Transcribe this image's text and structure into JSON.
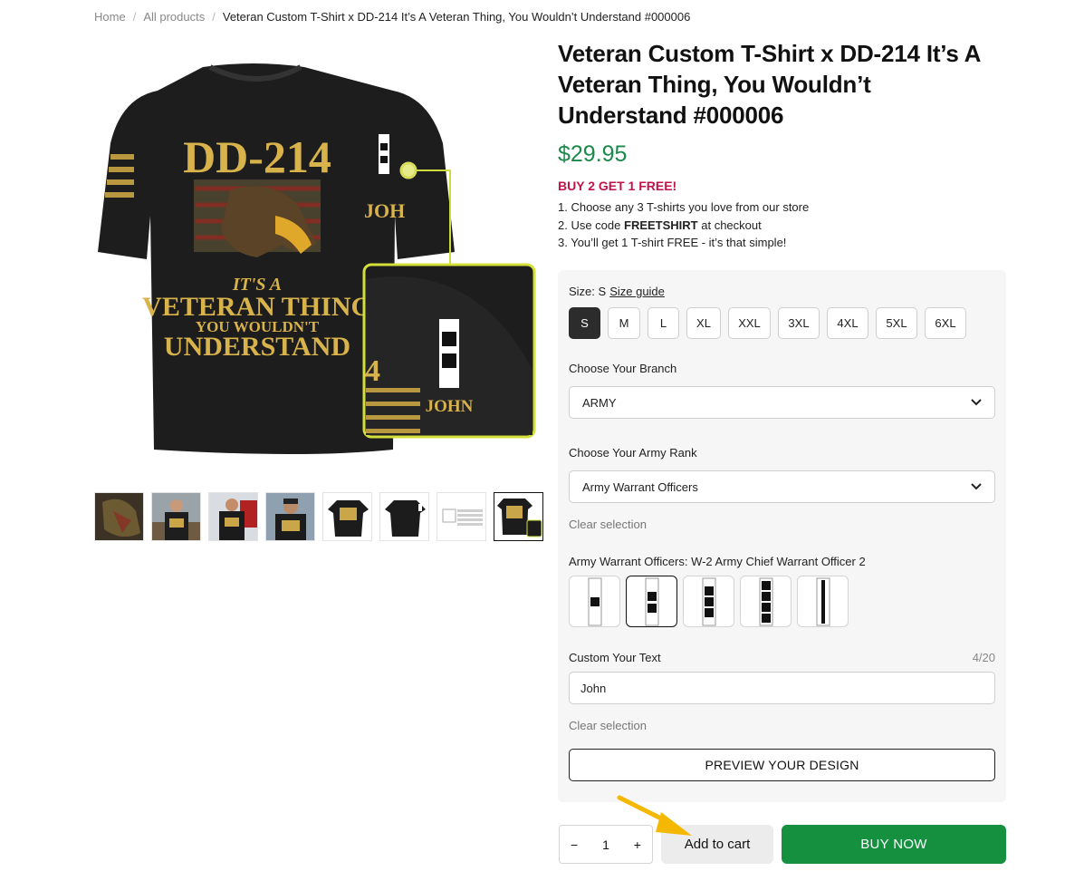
{
  "breadcrumb": {
    "home": "Home",
    "all_products": "All products",
    "current": "Veteran Custom T-Shirt x DD-214 It’s A Veteran Thing, You Wouldn’t Understand #000006",
    "separator": "/"
  },
  "product": {
    "title": "Veteran Custom T-Shirt x DD-214 It’s A Veteran Thing, You Wouldn’t Understand #000006",
    "price": "$29.95",
    "promo": "BUY 2 GET 1 FREE!",
    "step1": "1. Choose any 3 T-shirts you love from our store",
    "step2_pre": "2. Use code ",
    "step2_code": "FREETSHIRT",
    "step2_post": " at checkout",
    "step3": "3. You’ll get 1 T-shirt FREE - it’s that simple!"
  },
  "image": {
    "shirt_text_top": "DD-214",
    "shirt_text_mid1": "IT'S A",
    "shirt_text_mid2": "VETERAN THING",
    "shirt_text_mid3": "YOU WOULDN'T",
    "shirt_text_bottom": "UNDERSTAND",
    "sleeve_name": "JOHN",
    "sleeve_name_partial": "JOH",
    "sleeve_number_partial": "4"
  },
  "options": {
    "size_label": "Size: S",
    "size_guide": "Size guide",
    "sizes": [
      "S",
      "M",
      "L",
      "XL",
      "XXL",
      "3XL",
      "4XL",
      "5XL",
      "6XL"
    ],
    "selected_size": "S",
    "branch_label": "Choose Your Branch",
    "branch_value": "ARMY",
    "rank_label": "Choose Your Army Rank",
    "rank_value": "Army Warrant Officers",
    "clear_selection": "Clear selection",
    "insignia_label": "Army Warrant Officers: W-2 Army Chief Warrant Officer 2",
    "custom_text_label": "Custom Your Text",
    "custom_text_count": "4/20",
    "custom_text_value": "John",
    "clear_selection_2": "Clear selection",
    "preview_button": "PREVIEW YOUR DESIGN"
  },
  "purchase": {
    "minus": "−",
    "quantity": "1",
    "plus": "+",
    "add_to_cart": "Add to cart",
    "buy_now": "BUY NOW"
  },
  "colors": {
    "price_green": "#1a8a4a",
    "promo_red": "#c1134a",
    "buy_now_green": "#14903f",
    "arrow_yellow": "#f5b800",
    "shirt_gold": "#d8b24a"
  }
}
